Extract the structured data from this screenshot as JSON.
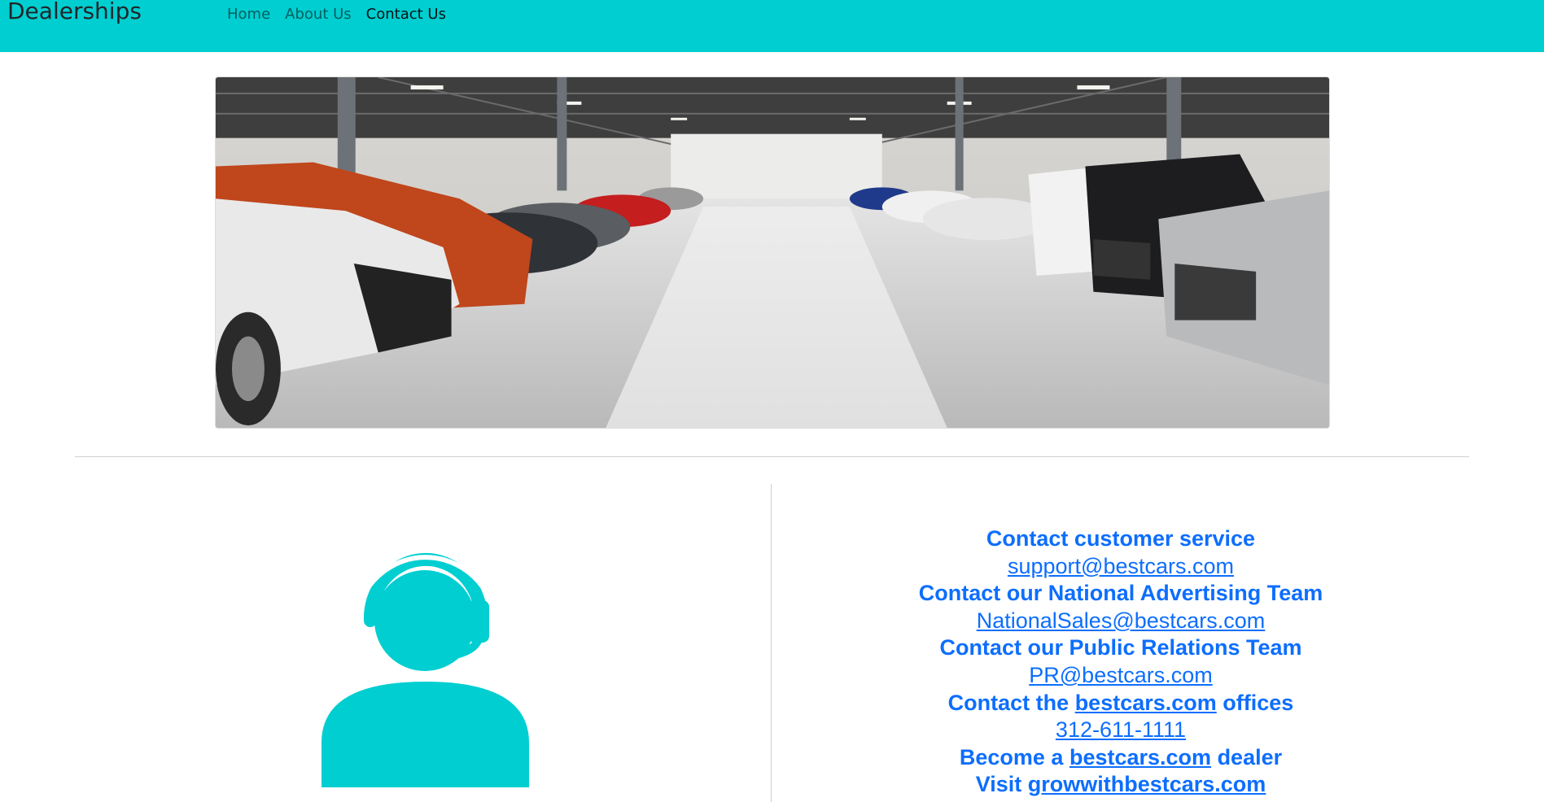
{
  "navbar": {
    "brand": "Dealerships",
    "links": [
      {
        "label": "Home",
        "active": false
      },
      {
        "label": "About Us",
        "active": false
      },
      {
        "label": "Contact Us",
        "active": true
      }
    ],
    "background": "#00ced1"
  },
  "hero": {
    "icon": "car-dealership-showroom-photo"
  },
  "agent": {
    "icon": "customer-service-agent-headset-icon",
    "color": "#00ced1"
  },
  "contact": {
    "customer_service_heading": "Contact customer service",
    "customer_service_email": "support@bestcars.com",
    "advertising_heading": "Contact our National Advertising Team",
    "advertising_email": "NationalSales@bestcars.com",
    "pr_heading": "Contact our Public Relations Team",
    "pr_email": "PR@bestcars.com",
    "offices_prefix": "Contact the",
    "offices_link": "bestcars.com",
    "offices_suffix": "offices",
    "offices_phone": "312-611-1111",
    "dealer_prefix": "Become a",
    "dealer_link": "bestcars.com",
    "dealer_suffix": "dealer",
    "visit_prefix": "Visit",
    "visit_link": "growwithbestcars.com",
    "link_color": "#0d6efd"
  }
}
